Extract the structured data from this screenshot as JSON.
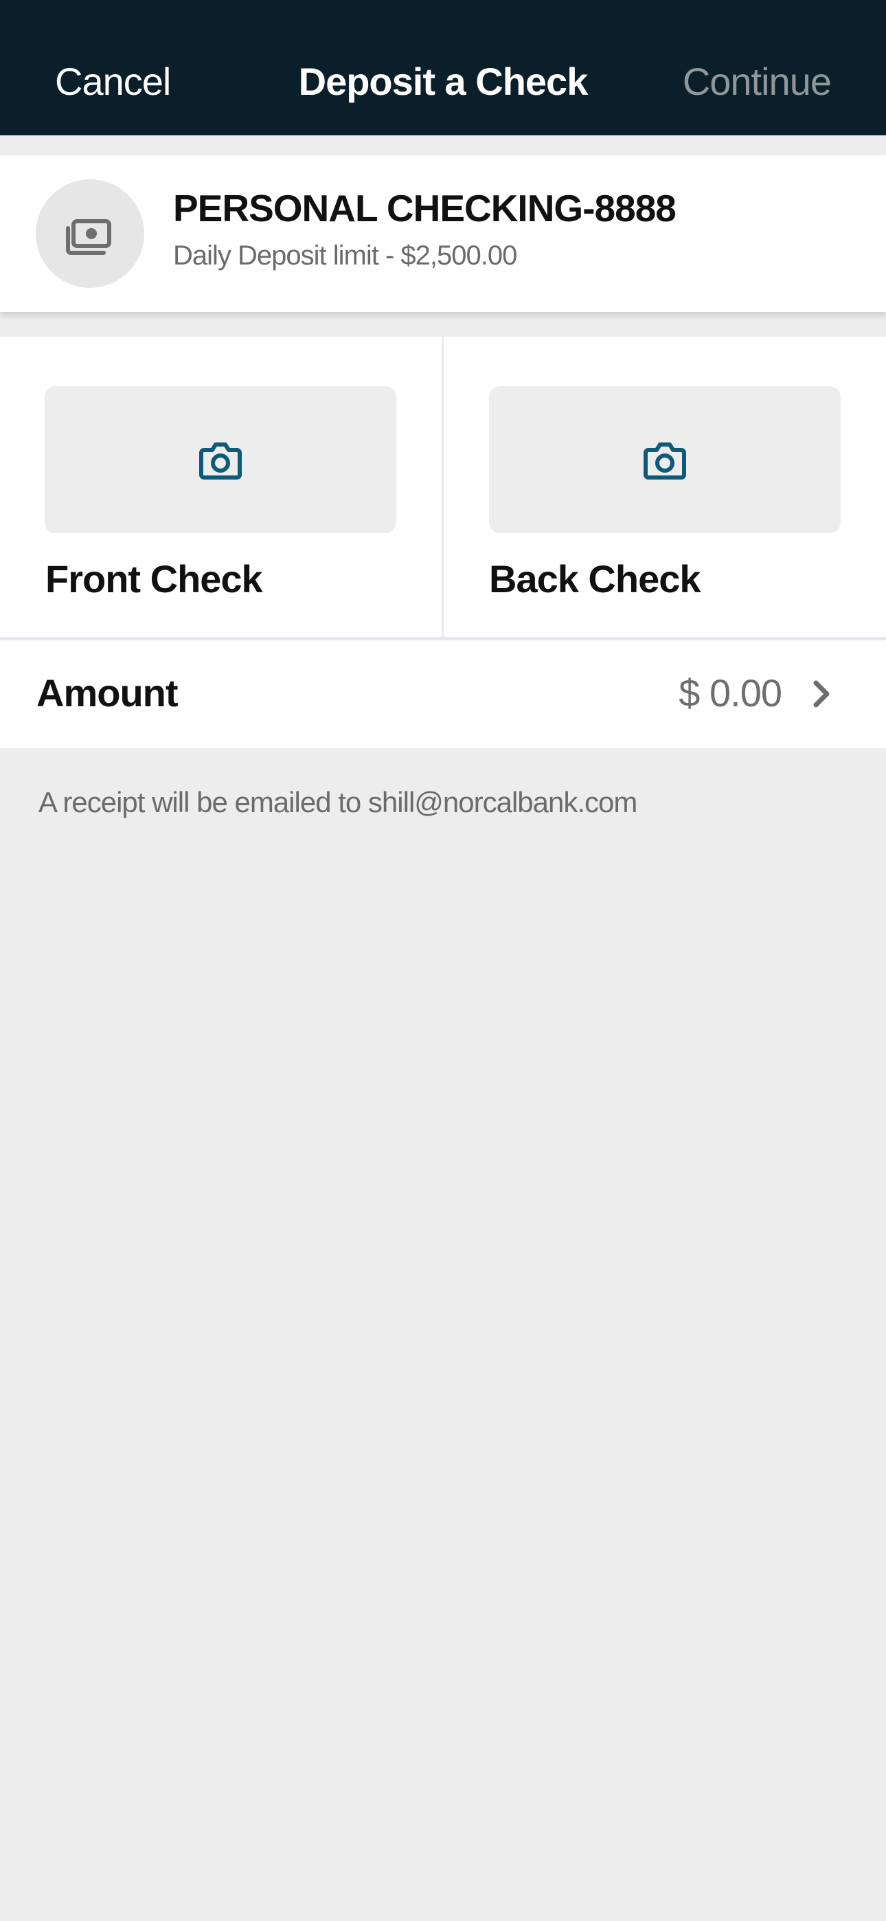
{
  "navbar": {
    "cancel_label": "Cancel",
    "title": "Deposit a Check",
    "continue_label": "Continue"
  },
  "account": {
    "icon": "cash-icon",
    "name": "PERSONAL CHECKING-8888",
    "limit_text": "Daily Deposit limit - $2,500.00"
  },
  "capture": {
    "front": {
      "icon": "camera-icon",
      "label": "Front Check"
    },
    "back": {
      "icon": "camera-icon",
      "label": "Back Check"
    }
  },
  "amount": {
    "label": "Amount",
    "value": "$ 0.00",
    "icon": "chevron-right-icon"
  },
  "receipt": {
    "text": "A receipt will be emailed to shill@norcalbank.com"
  },
  "colors": {
    "navbar_bg": "#0a1f29",
    "accent": "#0f5a7a",
    "background": "#ededed"
  }
}
